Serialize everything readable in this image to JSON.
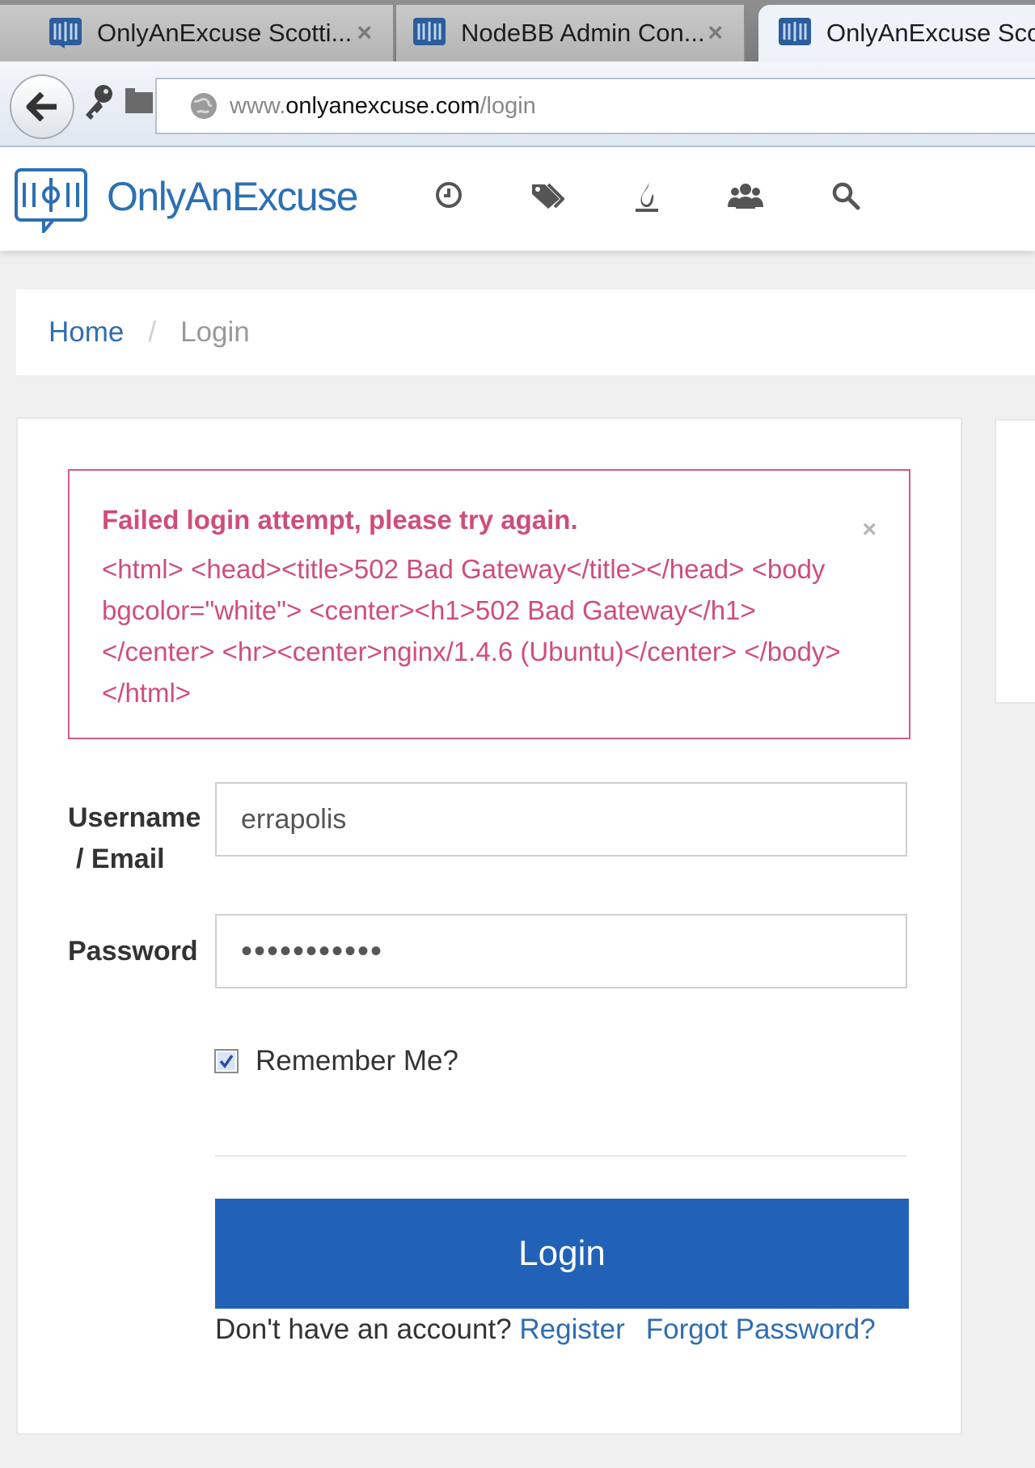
{
  "browser": {
    "tabs": [
      {
        "label": "OnlyAnExcuse Scotti...",
        "close": "×"
      },
      {
        "label": "NodeBB Admin Con...",
        "close": "×"
      },
      {
        "label": "OnlyAnExcuse Scot"
      }
    ],
    "url": {
      "prefix": "www.",
      "host": "onlyanexcuse.com",
      "path": "/login"
    }
  },
  "header": {
    "brand": "OnlyAnExcuse",
    "nav_icons": [
      "clock-icon",
      "tags-icon",
      "fire-icon",
      "users-icon",
      "search-icon"
    ]
  },
  "breadcrumb": {
    "home": "Home",
    "separator": "/",
    "current": "Login"
  },
  "alert": {
    "title": "Failed login attempt, please try again.",
    "body": "<html> <head><title>502 Bad Gateway</title></head> <body bgcolor=\"white\"> <center><h1>502 Bad Gateway</h1></center> <hr><center>nginx/1.4.6 (Ubuntu)</center> </body> </html>",
    "close": "×"
  },
  "form": {
    "username_label_line1": "Username",
    "username_label_line2": "/ Email",
    "username_value": "errapolis",
    "password_label": "Password",
    "password_value": "•••••••••••",
    "remember_label": "Remember Me?",
    "remember_checked": true,
    "login_button": "Login",
    "no_account_text": "Don't have an account? ",
    "register_link": "Register",
    "forgot_link": "Forgot Password?"
  },
  "colors": {
    "brand_blue": "#2c6fb5",
    "button_blue": "#2261b8",
    "alert_pink": "#cf4e79"
  }
}
